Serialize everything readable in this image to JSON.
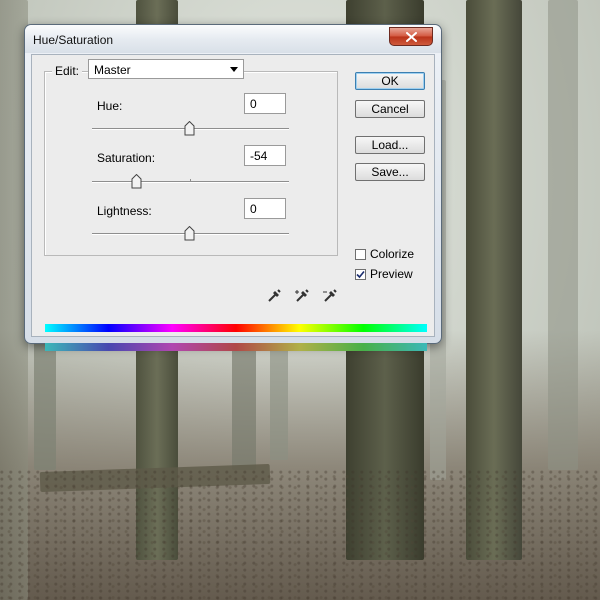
{
  "window": {
    "title": "Hue/Saturation",
    "close_icon": "close-icon"
  },
  "edit": {
    "label": "Edit:",
    "selected": "Master"
  },
  "adjustments": {
    "hue": {
      "label": "Hue:",
      "value": "0",
      "slider_fraction": 0.5
    },
    "saturation": {
      "label": "Saturation:",
      "value": "-54",
      "slider_fraction": 0.23
    },
    "lightness": {
      "label": "Lightness:",
      "value": "0",
      "slider_fraction": 0.5
    }
  },
  "buttons": {
    "ok": "OK",
    "cancel": "Cancel",
    "load": "Load...",
    "save": "Save..."
  },
  "options": {
    "colorize": {
      "label": "Colorize",
      "checked": false
    },
    "preview": {
      "label": "Preview",
      "checked": true
    }
  },
  "eyedroppers": [
    "eyedropper-icon",
    "eyedropper-plus-icon",
    "eyedropper-minus-icon"
  ],
  "colors": {
    "default_button_border": "#3c7fb1",
    "close_button": "#c7452c"
  }
}
